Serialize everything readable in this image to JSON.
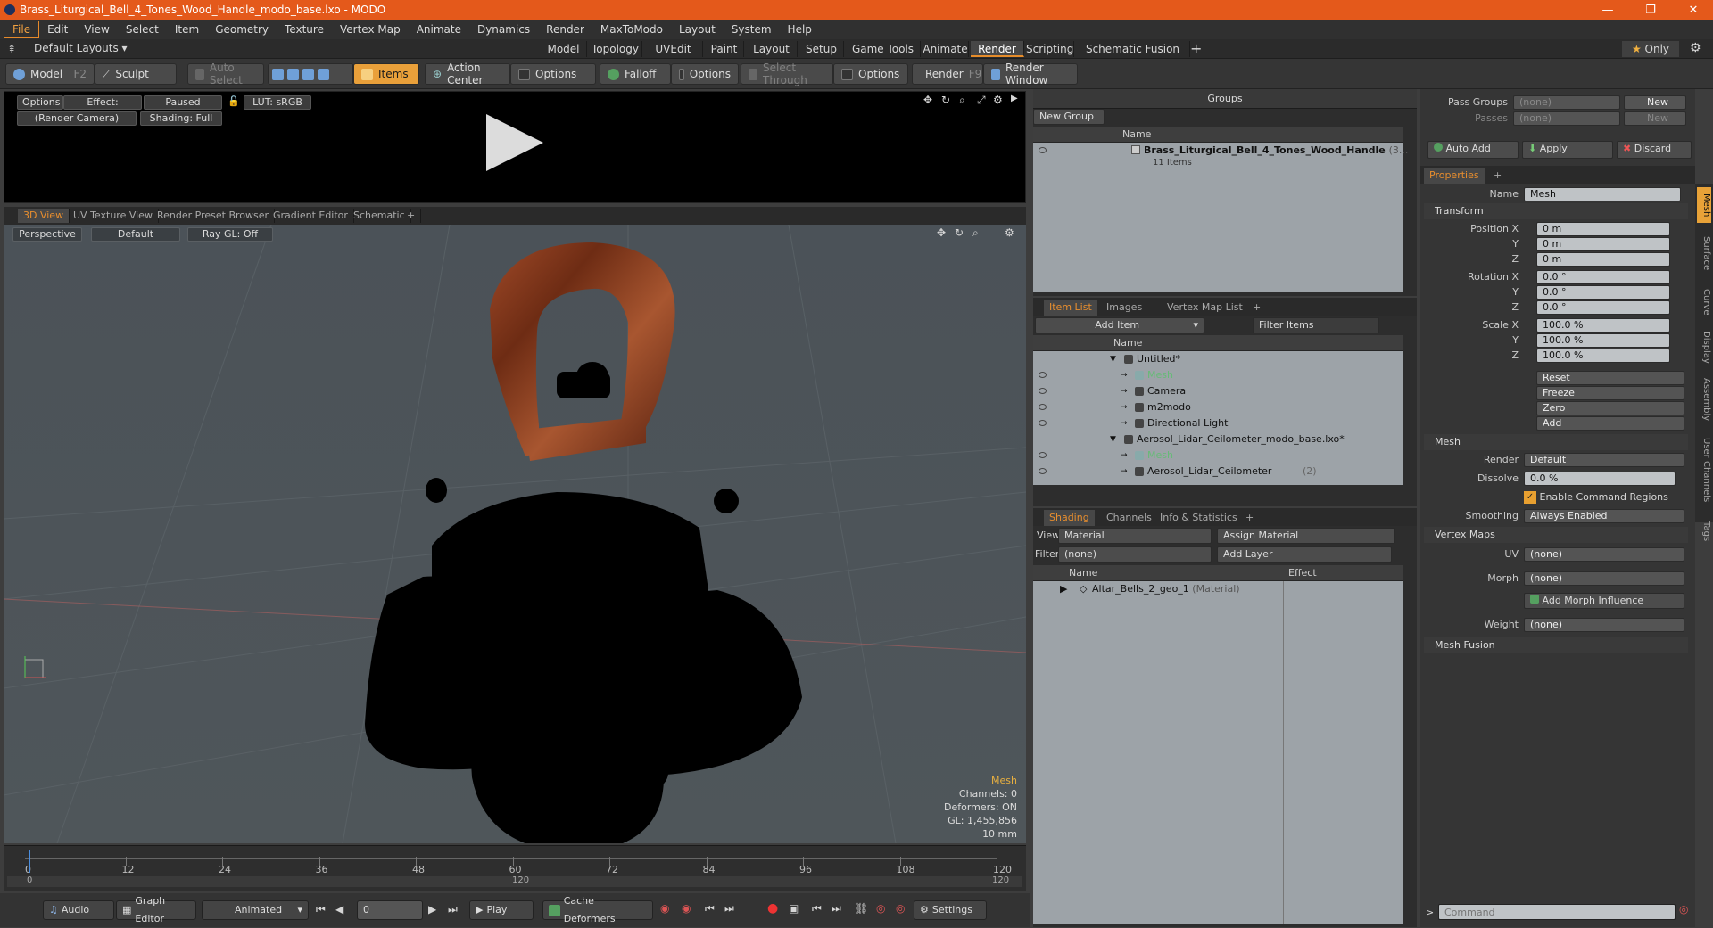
{
  "window": {
    "title": "Brass_Liturgical_Bell_4_Tones_Wood_Handle_modo_base.lxo - MODO"
  },
  "menu": [
    "File",
    "Edit",
    "View",
    "Select",
    "Item",
    "Geometry",
    "Texture",
    "Vertex Map",
    "Animate",
    "Dynamics",
    "Render",
    "MaxToModo",
    "Layout",
    "System",
    "Help"
  ],
  "layouts": {
    "dropdown": "Default Layouts",
    "tabs": [
      "Model",
      "Topology",
      "UVEdit",
      "Paint",
      "Layout",
      "Setup",
      "Game Tools",
      "Animate",
      "Render",
      "Scripting",
      "Schematic Fusion"
    ],
    "active": "Render",
    "only": "Only"
  },
  "toolbar": {
    "model": "Model",
    "model_key": "F2",
    "sculpt": "Sculpt",
    "auto_select": "Auto Select",
    "items": "Items",
    "action_center": "Action Center",
    "options1": "Options",
    "falloff": "Falloff",
    "options2": "Options",
    "select_through": "Select Through",
    "options3": "Options",
    "render": "Render",
    "render_key": "F9",
    "render_window": "Render Window"
  },
  "preview": {
    "options": "Options",
    "effect": "Effect: (Shadi...",
    "paused": "Paused",
    "lut": "LUT: sRGB",
    "camera": "(Render Camera)",
    "shading": "Shading: Full"
  },
  "viewport_tabs": [
    "3D View",
    "UV Texture View",
    "Render Preset Browser",
    "Gradient Editor",
    "Schematic"
  ],
  "viewport": {
    "perspective": "Perspective",
    "default": "Default",
    "raygl": "Ray GL: Off",
    "info": {
      "mesh": "Mesh",
      "channels": "Channels: 0",
      "deformers": "Deformers: ON",
      "gl": "GL: 1,455,856",
      "scale": "10 mm"
    }
  },
  "timeline": {
    "ticks": [
      "0",
      "12",
      "24",
      "36",
      "48",
      "60",
      "72",
      "84",
      "96",
      "108",
      "120"
    ],
    "sub0": "0",
    "sub120": "120",
    "sub120r": "120"
  },
  "bottom": {
    "audio": "Audio",
    "graph_editor": "Graph Editor",
    "animated": "Animated",
    "frame": "0",
    "play": "Play",
    "cache": "Cache Deformers",
    "settings": "Settings"
  },
  "groups": {
    "title": "Groups",
    "new_group": "New Group",
    "name_col": "Name",
    "item": "Brass_Liturgical_Bell_4_Tones_Wood_Handle",
    "item_suffix": "(3...",
    "count": "11 Items"
  },
  "itemlist": {
    "tabs": [
      "Item List",
      "Images",
      "Vertex Map List"
    ],
    "add_item": "Add Item",
    "filter": "Filter Items",
    "name_col": "Name",
    "rows": [
      {
        "label": "Untitled*",
        "indent": 0
      },
      {
        "label": "Mesh",
        "indent": 1,
        "dim": true
      },
      {
        "label": "Camera",
        "indent": 1
      },
      {
        "label": "m2modo",
        "indent": 1
      },
      {
        "label": "Directional Light",
        "indent": 1
      },
      {
        "label": "Aerosol_Lidar_Ceilometer_modo_base.lxo*",
        "indent": 0
      },
      {
        "label": "Mesh",
        "indent": 1,
        "dim": true
      },
      {
        "label": "Aerosol_Lidar_Ceilometer",
        "indent": 1,
        "suffix": "(2)"
      }
    ]
  },
  "shading": {
    "tabs": [
      "Shading",
      "Channels",
      "Info & Statistics"
    ],
    "view_label": "View",
    "view_val": "Material",
    "assign": "Assign Material",
    "filter_label": "Filter",
    "filter_val": "(none)",
    "add_layer": "Add Layer",
    "name_col": "Name",
    "effect_col": "Effect",
    "row": "Altar_Bells_2_geo_1",
    "row_suffix": "(Material)"
  },
  "passes": {
    "pass_groups": "Pass Groups",
    "pass_val": "(none)",
    "passes": "Passes",
    "passes_val": "(none)",
    "new": "New",
    "new2": "New",
    "auto_add": "Auto Add",
    "apply": "Apply",
    "discard": "Discard"
  },
  "properties": {
    "tab": "Properties",
    "name_label": "Name",
    "name_val": "Mesh",
    "transform": "Transform",
    "pos_label": "Position X",
    "rot_label": "Rotation X",
    "scale_label": "Scale X",
    "y": "Y",
    "z": "Z",
    "pos": [
      "0 m",
      "0 m",
      "0 m"
    ],
    "rot": [
      "0.0 °",
      "0.0 °",
      "0.0 °"
    ],
    "scale": [
      "100.0 %",
      "100.0 %",
      "100.0 %"
    ],
    "reset": "Reset",
    "freeze": "Freeze",
    "zero": "Zero",
    "add": "Add",
    "mesh": "Mesh",
    "render_label": "Render",
    "render_val": "Default",
    "dissolve_label": "Dissolve",
    "dissolve_val": "0.0 %",
    "ecr": "Enable Command Regions",
    "smoothing_label": "Smoothing",
    "smoothing_val": "Always Enabled",
    "vertex_maps": "Vertex Maps",
    "uv_label": "UV",
    "uv_val": "(none)",
    "morph_label": "Morph",
    "morph_val": "(none)",
    "add_morph": "Add Morph Influence",
    "weight_label": "Weight",
    "weight_val": "(none)",
    "mesh_fusion": "Mesh Fusion",
    "command_placeholder": "Command"
  },
  "side_tabs": [
    "Mesh",
    "Surface",
    "Curve",
    "Display",
    "Assembly",
    "User Channels",
    "Tags"
  ],
  "colors": {
    "accent": "#e4591b",
    "orange": "#e88e2e",
    "wood": "#8a3a1e"
  }
}
